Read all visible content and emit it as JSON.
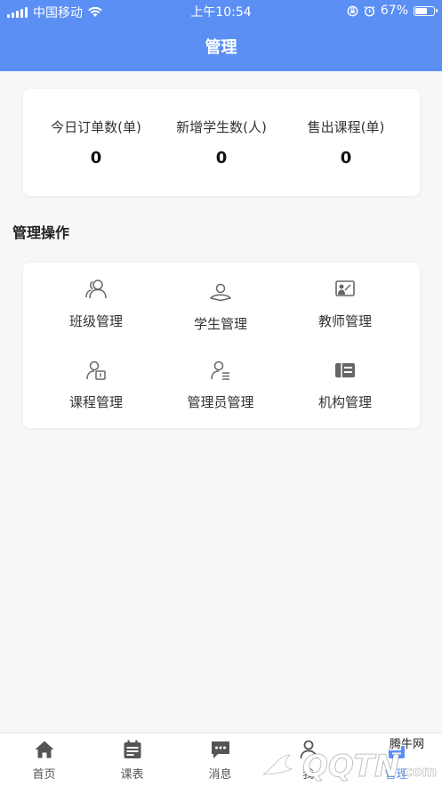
{
  "status_bar": {
    "carrier": "中国移动",
    "time": "上午10:54",
    "battery": "67%",
    "battery_level": 0.67
  },
  "header": {
    "title": "管理"
  },
  "stats": [
    {
      "label": "今日订单数(单)",
      "value": "0"
    },
    {
      "label": "新增学生数(人)",
      "value": "0"
    },
    {
      "label": "售出课程(单)",
      "value": "0"
    }
  ],
  "section": {
    "title": "管理操作"
  },
  "operations": [
    {
      "label": "班级管理",
      "icon": "users-icon"
    },
    {
      "label": "学生管理",
      "icon": "student-icon"
    },
    {
      "label": "教师管理",
      "icon": "teacher-board-icon"
    },
    {
      "label": "课程管理",
      "icon": "course-icon"
    },
    {
      "label": "管理员管理",
      "icon": "admin-list-icon"
    },
    {
      "label": "机构管理",
      "icon": "institution-icon"
    }
  ],
  "tabs": [
    {
      "label": "首页",
      "icon": "home-icon"
    },
    {
      "label": "课表",
      "icon": "calendar-icon"
    },
    {
      "label": "消息",
      "icon": "message-icon"
    },
    {
      "label": "我",
      "icon": "user-icon"
    },
    {
      "label": "管理",
      "icon": "manage-icon"
    }
  ],
  "watermark": {
    "text": "QQTN",
    "subtext": "腾牛网",
    "suffix": ".com"
  },
  "colors": {
    "primary": "#5b8ff4",
    "icon_gray": "#666666",
    "tab_gray": "#555555"
  }
}
